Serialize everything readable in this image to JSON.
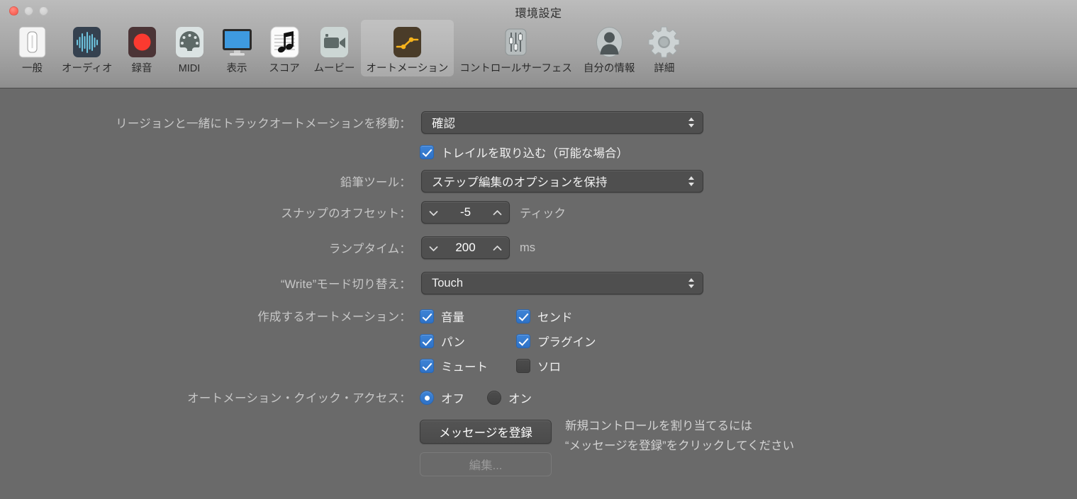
{
  "window": {
    "title": "環境設定",
    "traffic_lights": [
      "close",
      "minimize",
      "zoom"
    ],
    "background_color": "#6a6a6a",
    "accent_color": "#3478c8"
  },
  "toolbar": {
    "selected": "オートメーション",
    "items": [
      {
        "label": "一般",
        "icon": "toggle-switch-icon"
      },
      {
        "label": "オーディオ",
        "icon": "waveform-icon"
      },
      {
        "label": "録音",
        "icon": "record-circle-icon"
      },
      {
        "label": "MIDI",
        "icon": "midi-connector-icon"
      },
      {
        "label": "表示",
        "icon": "display-monitor-icon"
      },
      {
        "label": "スコア",
        "icon": "music-note-staff-icon"
      },
      {
        "label": "ムービー",
        "icon": "video-camera-icon"
      },
      {
        "label": "オートメーション",
        "icon": "automation-curve-icon"
      },
      {
        "label": "コントロールサーフェス",
        "icon": "sliders-icon"
      },
      {
        "label": "自分の情報",
        "icon": "person-avatar-icon"
      },
      {
        "label": "詳細",
        "icon": "gear-icon"
      }
    ]
  },
  "form": {
    "move_track_automation": {
      "label": "リージョンと一緒にトラックオートメーションを移動：",
      "value": "確認"
    },
    "capture_trails": {
      "label": "トレイルを取り込む（可能な場合）",
      "checked": true
    },
    "pencil_tool": {
      "label": "鉛筆ツール：",
      "value": "ステップ編集のオプションを保持"
    },
    "snap_offset": {
      "label": "スナップのオフセット：",
      "value": "-5",
      "unit": "ティック"
    },
    "ramp_time": {
      "label": "ランプタイム：",
      "value": "200",
      "unit": "ms"
    },
    "write_mode": {
      "label": "“Write”モード切り替え：",
      "value": "Touch"
    },
    "automation_to_create": {
      "label": "作成するオートメーション：",
      "options": [
        {
          "label": "音量",
          "checked": true
        },
        {
          "label": "センド",
          "checked": true
        },
        {
          "label": "パン",
          "checked": true
        },
        {
          "label": "プラグイン",
          "checked": true
        },
        {
          "label": "ミュート",
          "checked": true
        },
        {
          "label": "ソロ",
          "checked": false
        }
      ]
    },
    "quick_access": {
      "label": "オートメーション・クイック・アクセス：",
      "options": [
        {
          "label": "オフ",
          "selected": true
        },
        {
          "label": "オン",
          "selected": false
        }
      ]
    },
    "learn_message_button": {
      "label": "メッセージを登録",
      "enabled": true
    },
    "edit_button": {
      "label": "編集...",
      "enabled": false
    },
    "hint_line1": "新規コントロールを割り当てるには",
    "hint_line2": "“メッセージを登録”をクリックしてください"
  }
}
